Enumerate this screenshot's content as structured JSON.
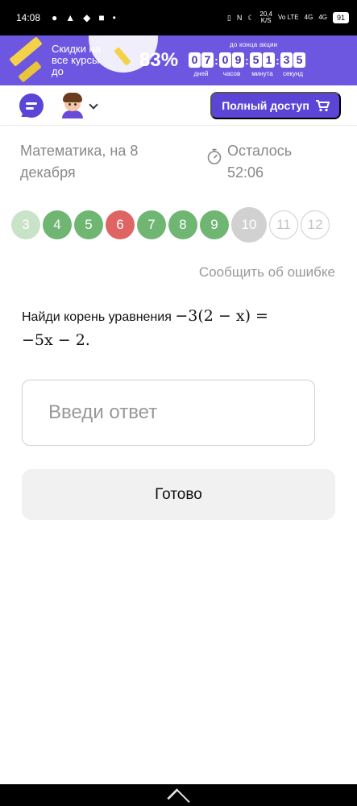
{
  "status_bar": {
    "time": "14:08",
    "net_speed": "20,4",
    "net_unit": "K/S",
    "volte": "Vo LTE",
    "signal1": "4G",
    "signal2": "4G",
    "battery": "91"
  },
  "promo": {
    "text": "Скидки на все курсы до",
    "percent": "83%",
    "until_label": "до конца акции",
    "timer": [
      {
        "digits": [
          "0",
          "7"
        ],
        "label": "дней"
      },
      {
        "digits": [
          "0",
          "9"
        ],
        "label": "часов"
      },
      {
        "digits": [
          "5",
          "1"
        ],
        "label": "минута"
      },
      {
        "digits": [
          "3",
          "5"
        ],
        "label": "секунд"
      }
    ]
  },
  "header": {
    "full_access_label": "Полный доступ"
  },
  "test": {
    "subject": "Математика, на 8 декабря",
    "remaining_label": "Осталось",
    "remaining_time": "52:06"
  },
  "questions": [
    {
      "n": "3",
      "state": "faded"
    },
    {
      "n": "4",
      "state": "green"
    },
    {
      "n": "5",
      "state": "green"
    },
    {
      "n": "6",
      "state": "red"
    },
    {
      "n": "7",
      "state": "green"
    },
    {
      "n": "8",
      "state": "green"
    },
    {
      "n": "9",
      "state": "green"
    },
    {
      "n": "10",
      "state": "current"
    },
    {
      "n": "11",
      "state": "empty"
    },
    {
      "n": "12",
      "state": "empty"
    }
  ],
  "report_label": "Сообщить об ошибке",
  "task": {
    "prefix": "Найди корень уравнения",
    "equation_line1": "−3(2 − x) =",
    "equation_line2": "−5x − 2."
  },
  "answer": {
    "placeholder": "Введи ответ",
    "value": ""
  },
  "done_label": "Готово",
  "colors": {
    "accent": "#5b45d6",
    "promo_bg": "#6e57e0",
    "correct": "#6fb672",
    "wrong": "#df6565"
  }
}
